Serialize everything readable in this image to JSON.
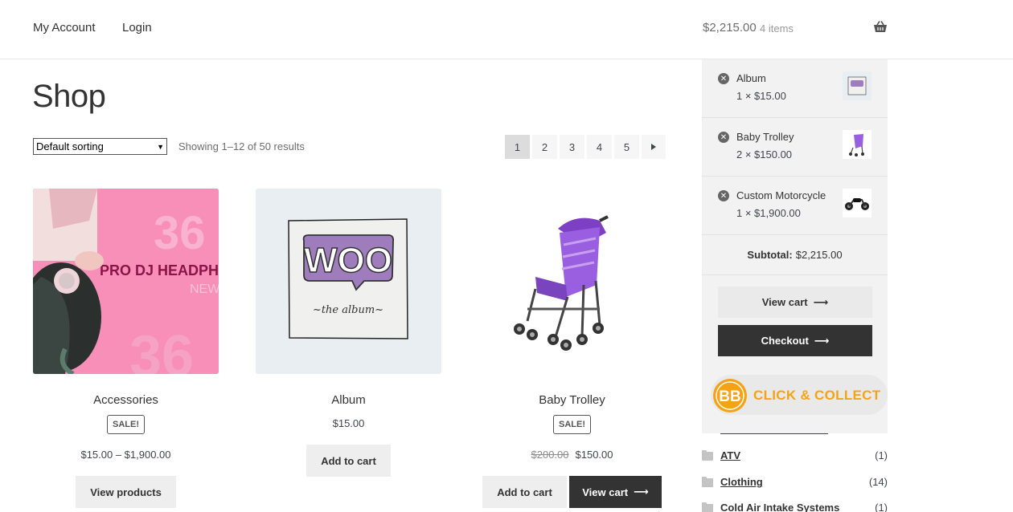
{
  "header": {
    "nav": [
      "My Account",
      "Login"
    ],
    "cart_total": "$2,215.00",
    "cart_count": "4 items",
    "basket_icon": "basket-icon"
  },
  "page": {
    "title": "Shop",
    "sort_selected": "Default sorting",
    "result_count": "Showing 1–12 of 50 results",
    "pagination": [
      "1",
      "2",
      "3",
      "4",
      "5"
    ],
    "current_page": "1",
    "next_icon": "caret-right-icon"
  },
  "products": [
    {
      "title": "Accessories",
      "sale_badge": "SALE!",
      "price": "$15.00 – $1,900.00",
      "button": "View products",
      "image_text": {
        "number": "36",
        "headline": "PRO DJ HEADPH",
        "sub": "NEW"
      }
    },
    {
      "title": "Album",
      "price": "$15.00",
      "button": "Add to cart",
      "image_text": {
        "logo": "WOO",
        "sub": "~the album~"
      }
    },
    {
      "title": "Baby Trolley",
      "sale_badge": "SALE!",
      "old_price": "$200.00",
      "price": "$150.00",
      "button": "Add to cart",
      "button2": "View cart"
    }
  ],
  "minicart": {
    "items": [
      {
        "name": "Album",
        "qty": "1 × $15.00"
      },
      {
        "name": "Baby Trolley",
        "qty": "2 × $150.00"
      },
      {
        "name": "Custom Motorcycle",
        "qty": "1 × $1,900.00"
      }
    ],
    "subtotal_label": "Subtotal:",
    "subtotal_value": "$2,215.00",
    "view_cart": "View cart",
    "checkout": "Checkout"
  },
  "banner": {
    "text": "CLICK & COLLECT",
    "logo_text": "BB",
    "brand_color": "#f5a315"
  },
  "categories": [
    {
      "name": "ATV",
      "count": "(1)"
    },
    {
      "name": "Clothing",
      "count": "(14)"
    },
    {
      "name": "Cold Air Intake Systems",
      "count": "(1)"
    }
  ],
  "colors": {
    "dark_button": "#333333",
    "light_button": "#eeeeee",
    "sale_pink": "#f58fb8",
    "album_bg": "#e8eef2",
    "album_purple": "#a37fc0"
  }
}
